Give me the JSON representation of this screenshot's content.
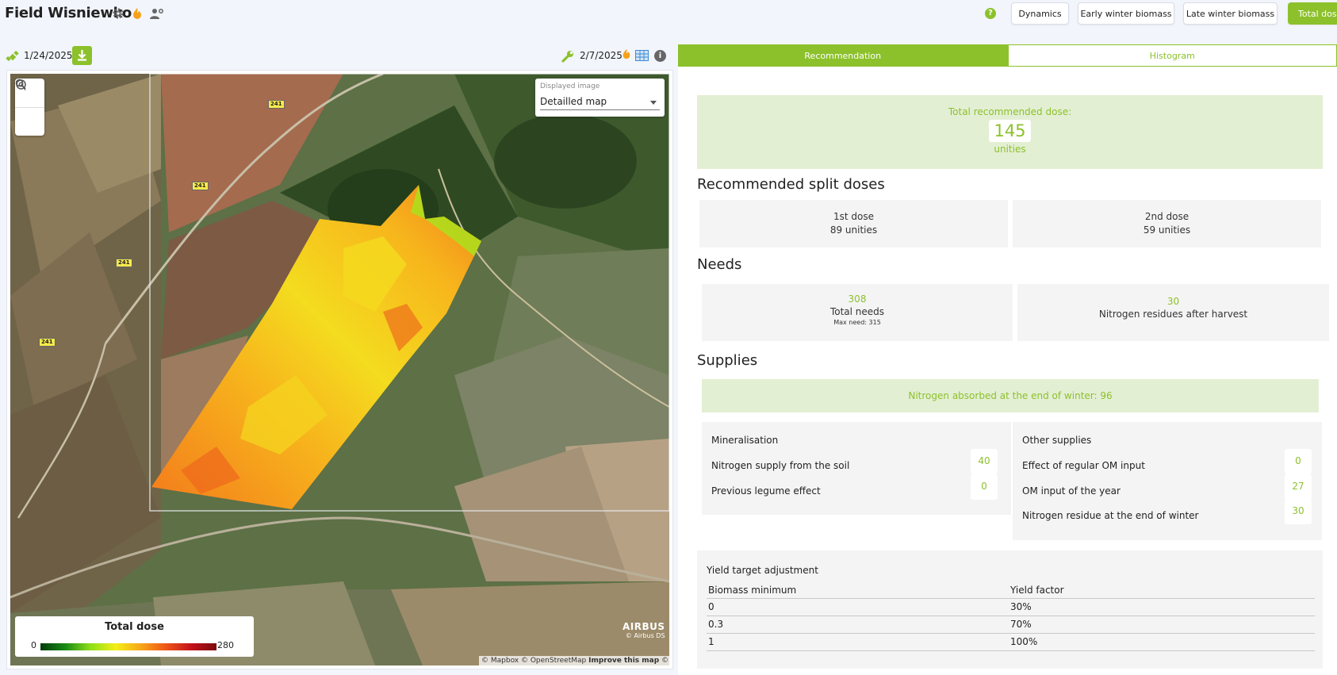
{
  "header": {
    "title": "Field Wisniewko",
    "buttons": [
      "Dynamics",
      "Early winter biomass",
      "Late winter biomass",
      "Total dose"
    ],
    "help": "?"
  },
  "toolbar": {
    "date_left": "1/24/2025",
    "date_right": "2/7/2025"
  },
  "map": {
    "displayed_image_label": "Displayed image",
    "displayed_image_value": "Detailled map",
    "legend": {
      "title": "Total dose",
      "min": "0",
      "max": "280"
    },
    "airbus": "AIRBUS",
    "airbus_ds": "© Airbus DS",
    "attribution": "© Mapbox © OpenStreetMap",
    "improve": "Improve this map",
    "maxar": "© Maxar",
    "road_label": "241"
  },
  "tabs": [
    "Recommendation",
    "Histogram"
  ],
  "total": {
    "label": "Total recommended dose:",
    "value": "145",
    "unit": "unities"
  },
  "split": {
    "title": "Recommended split doses",
    "doses": [
      {
        "name": "1st dose",
        "value": "89 unities"
      },
      {
        "name": "2nd dose",
        "value": "59 unities"
      }
    ]
  },
  "needs": {
    "title": "Needs",
    "total_value": "308",
    "total_label": "Total needs",
    "max_need": "Max need: 315",
    "residues_value": "30",
    "residues_label": "Nitrogen residues after harvest"
  },
  "supplies": {
    "title": "Supplies",
    "absorbed": "Nitrogen absorbed at the end of winter:  96",
    "mineralisation": {
      "title": "Mineralisation",
      "rows": [
        {
          "label": "Nitrogen supply from the soil",
          "value": "40"
        },
        {
          "label": "Previous legume effect",
          "value": "0"
        }
      ]
    },
    "other": {
      "title": "Other supplies",
      "rows": [
        {
          "label": "Effect of regular OM input",
          "value": "0"
        },
        {
          "label": "OM input of the year",
          "value": "27"
        },
        {
          "label": "Nitrogen residue at the end of winter",
          "value": "30"
        }
      ]
    }
  },
  "yield": {
    "title": "Yield target adjustment",
    "headers": [
      "Biomass minimum",
      "Yield factor"
    ],
    "rows": [
      [
        "0",
        "30%"
      ],
      [
        "0.3",
        "70%"
      ],
      [
        "1",
        "100%"
      ]
    ]
  },
  "colors": {
    "accent": "#8cc12b",
    "accent_light": "#e3efd3",
    "card": "#f4f4f4"
  }
}
